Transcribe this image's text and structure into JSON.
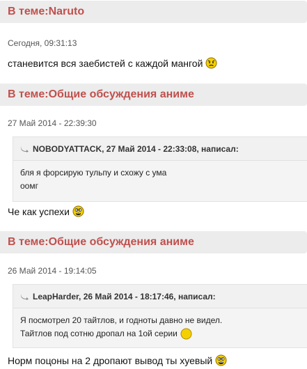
{
  "posts": [
    {
      "topic": "В теме:Naruto",
      "date": "Сегодня, 09:31:13",
      "text": "станевится вся заебистей с каждой мангой",
      "smiley": "angry-smiley-icon"
    },
    {
      "topic": "В теме:Общие обсуждения аниме",
      "date": "27 Май 2014 - 22:39:30",
      "quote": {
        "header": "NOBODYATTACK, 27 Май 2014 - 22:33:08, написал:",
        "lines": [
          "бля я форсирую тульпу и схожу с ума",
          "оомг"
        ]
      },
      "text": "Че как успехи",
      "smiley": "crazy-smiley-icon"
    },
    {
      "topic": "В теме:Общие обсуждения аниме",
      "date": "26 Май 2014 - 19:14:05",
      "quote": {
        "header": "LeapHarder, 26 Май 2014 - 18:17:46, написал:",
        "lines": [
          "Я посмотрел 20 тайтлов, и годноты давно не видел.",
          "Тайтлов под сотню дропал на 1ой серии"
        ]
      },
      "text": "Норм поцоны на 2 дропают вывод ты хуевый",
      "smiley": "crazy-smiley-icon"
    }
  ],
  "colors": {
    "topic_link": "#c0504d",
    "header_bg": "#ececec",
    "quote_bg": "#f4f4f4",
    "smiley_yellow": "#f5d000"
  }
}
